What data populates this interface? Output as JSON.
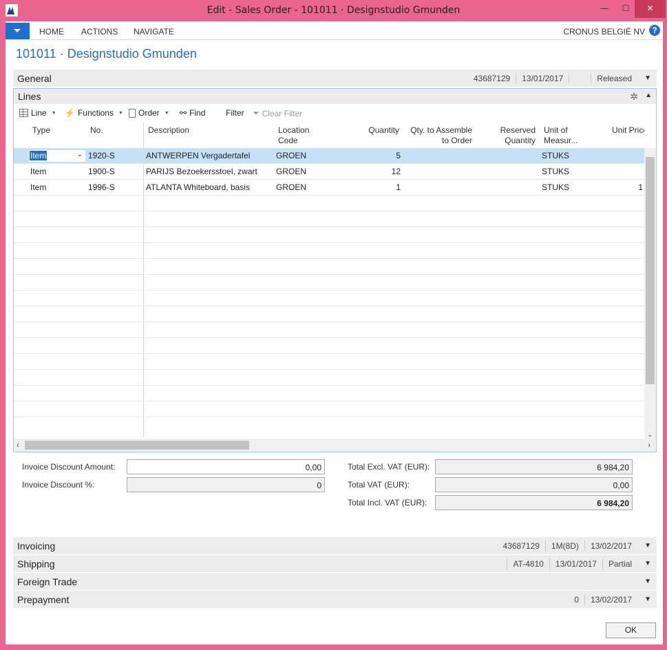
{
  "window": {
    "title": "Edit - Sales Order - 101011 · Designstudio Gmunden",
    "minimize": "—",
    "maximize": "☐",
    "close": "✕"
  },
  "ribbon": {
    "tabs": [
      "HOME",
      "ACTIONS",
      "NAVIGATE"
    ],
    "company": "CRONUS BELGIË NV",
    "help": "?"
  },
  "page_title": "101011 · Designstudio Gmunden",
  "general": {
    "title": "General",
    "values": [
      "43687129",
      "13/01/2017",
      "",
      "Released"
    ]
  },
  "lines": {
    "title": "Lines",
    "toolbar": {
      "line": "Line",
      "functions": "Functions",
      "order": "Order",
      "find": "Find",
      "filter": "Filter",
      "clear_filter": "Clear Filter"
    },
    "columns": {
      "type": "Type",
      "no": "No.",
      "description": "Description",
      "location": "Location\nCode",
      "quantity": "Quantity",
      "qty_assemble": "Qty. to Assemble\nto Order",
      "reserved": "Reserved\nQuantity",
      "uom": "Unit of\nMeasur...",
      "unit_price": "Unit Price"
    },
    "rows": [
      {
        "type": "Item",
        "no": "1920-S",
        "description": "ANTWERPEN Vergadertafel",
        "location": "GROEN",
        "quantity": "5",
        "uom": "STUKS",
        "unit_price": ""
      },
      {
        "type": "Item",
        "no": "1900-S",
        "description": "PARIJS Bezoekersstoel, zwart",
        "location": "GROEN",
        "quantity": "12",
        "uom": "STUKS",
        "unit_price": ""
      },
      {
        "type": "Item",
        "no": "1996-S",
        "description": "ATLANTA Whiteboard, basis",
        "location": "GROEN",
        "quantity": "1",
        "uom": "STUKS",
        "unit_price": "1"
      }
    ]
  },
  "totals": {
    "invoice_discount_amount_label": "Invoice Discount Amount:",
    "invoice_discount_amount": "0,00",
    "invoice_discount_pct_label": "Invoice Discount %:",
    "invoice_discount_pct": "0",
    "total_excl_label": "Total Excl. VAT (EUR):",
    "total_excl": "6 984,20",
    "total_vat_label": "Total VAT (EUR):",
    "total_vat": "0,00",
    "total_incl_label": "Total Incl. VAT (EUR):",
    "total_incl": "6 984,20"
  },
  "invoicing": {
    "title": "Invoicing",
    "values": [
      "43687129",
      "1M(8D)",
      "13/02/2017"
    ]
  },
  "shipping": {
    "title": "Shipping",
    "values": [
      "AT-4810",
      "13/01/2017",
      "Partial"
    ]
  },
  "foreign_trade": {
    "title": "Foreign Trade",
    "values": []
  },
  "prepayment": {
    "title": "Prepayment",
    "values": [
      "0",
      "13/02/2017"
    ]
  },
  "ok_button": "OK",
  "colors": {
    "accent": "#1f6fcf",
    "window_frame": "#e9648f",
    "selected_row": "#c6e0f6"
  }
}
